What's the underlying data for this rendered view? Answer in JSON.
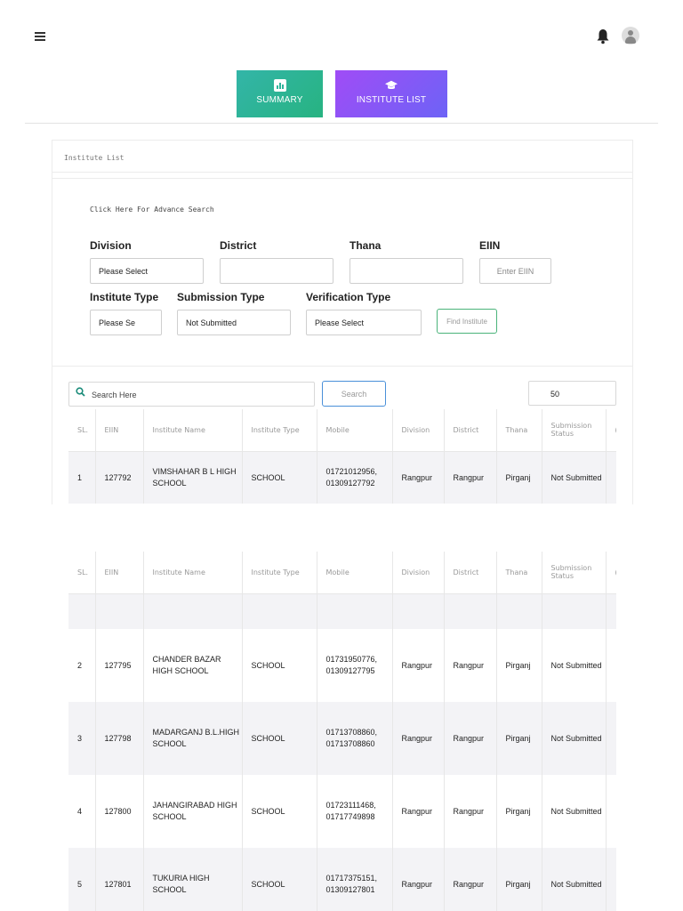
{
  "header": {
    "menu_icon": "hamburger-icon",
    "bell_icon": "bell-icon",
    "avatar_icon": "user-avatar-icon"
  },
  "nav": {
    "summary_label": "SUMMARY",
    "summary_icon": "chart-icon",
    "institute_label": "INSTITUTE LIST",
    "institute_icon": "graduation-cap-icon",
    "summary_color": "#2fb59a",
    "institute_color": "#8f55f6"
  },
  "card": {
    "title": "Institute List"
  },
  "search_panel": {
    "advance_link": "Click Here For Advance Search",
    "division_label": "Division",
    "division_value": "Please Select",
    "district_label": "District",
    "district_value": "",
    "thana_label": "Thana",
    "thana_value": "",
    "eiin_label": "EIIN",
    "eiin_placeholder": "Enter EIIN",
    "institute_type_label": "Institute Type",
    "institute_type_value": "Please Se",
    "submission_type_label": "Submission Type",
    "submission_type_value": "Not Submitted",
    "verification_type_label": "Verification Type",
    "verification_type_value": "Please Select",
    "find_button": "Find Institute"
  },
  "table_controls": {
    "search_placeholder": "Search Here",
    "search_button": "Search",
    "page_size": "50"
  },
  "table": {
    "columns": [
      "SL.",
      "EIIN",
      "Institute Name",
      "Institute Type",
      "Mobile",
      "Division",
      "District",
      "Thana",
      "Submission Status"
    ],
    "rows": [
      {
        "sl": "1",
        "eiin": "127792",
        "name": "VIMSHAHAR B L HIGH SCHOOL",
        "type": "SCHOOL",
        "mobile": "01721012956, 01309127792",
        "division": "Rangpur",
        "district": "Rangpur",
        "thana": "Pirganj",
        "status": "Not Submitted"
      },
      {
        "sl": "2",
        "eiin": "127795",
        "name": "CHANDER BAZAR HIGH SCHOOL",
        "type": "SCHOOL",
        "mobile": "01731950776, 01309127795",
        "division": "Rangpur",
        "district": "Rangpur",
        "thana": "Pirganj",
        "status": "Not Submitted"
      },
      {
        "sl": "3",
        "eiin": "127798",
        "name": "MADARGANJ B.L.HIGH SCHOOL",
        "type": "SCHOOL",
        "mobile": "01713708860, 01713708860",
        "division": "Rangpur",
        "district": "Rangpur",
        "thana": "Pirganj",
        "status": "Not Submitted"
      },
      {
        "sl": "4",
        "eiin": "127800",
        "name": "JAHANGIRABAD HIGH SCHOOL",
        "type": "SCHOOL",
        "mobile": "01723111468, 01717749898",
        "division": "Rangpur",
        "district": "Rangpur",
        "thana": "Pirganj",
        "status": "Not Submitted"
      },
      {
        "sl": "5",
        "eiin": "127801",
        "name": "TUKURIA HIGH SCHOOL",
        "type": "SCHOOL",
        "mobile": "01717375151, 01309127801",
        "division": "Rangpur",
        "district": "Rangpur",
        "thana": "Pirganj",
        "status": "Not Submitted"
      }
    ]
  }
}
